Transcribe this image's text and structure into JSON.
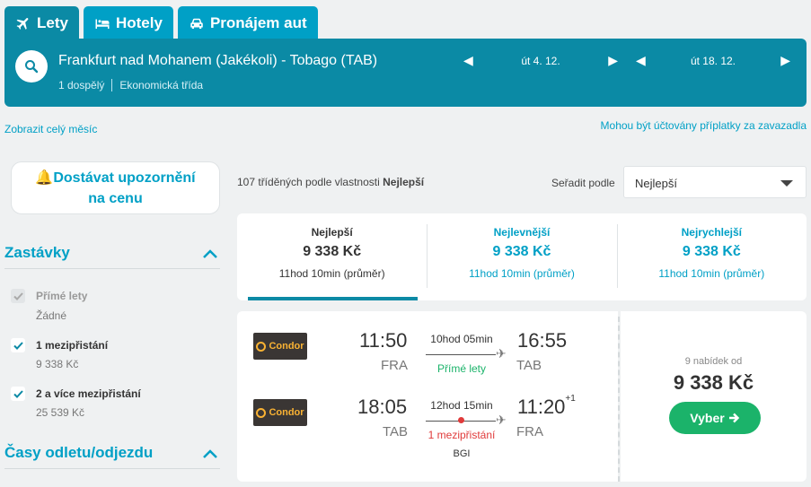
{
  "tabs": [
    {
      "label": "Lety",
      "icon": "plane-icon"
    },
    {
      "label": "Hotely",
      "icon": "bed-icon"
    },
    {
      "label": "Pronájem aut",
      "icon": "car-icon"
    }
  ],
  "search": {
    "route": "Frankfurt nad Mohanem (Jakékoli) - Tobago (TAB)",
    "passengers": "1 dospělý",
    "cabin": "Ekonomická třída",
    "depart_date": "út 4. 12.",
    "return_date": "út 18. 12."
  },
  "links": {
    "whole_month": "Zobrazit celý měsíc",
    "baggage_fees": "Mohou být účtovány příplatky za zavazadla"
  },
  "sidebar": {
    "alert_line1": "Dostávat upozornění",
    "alert_line2": "na cenu",
    "stops_title": "Zastávky",
    "stops": [
      {
        "label": "Přímé lety",
        "sub": "Žádné",
        "checked": true,
        "disabled": true
      },
      {
        "label": "1 mezipřistání",
        "sub": "9 338 Kč",
        "checked": true,
        "disabled": false
      },
      {
        "label": "2 a více mezipřistání",
        "sub": "25 539 Kč",
        "checked": true,
        "disabled": false
      }
    ],
    "times_title": "Časy odletu/odjezdu"
  },
  "results": {
    "count_prefix": "107 tříděných podle vlastnosti",
    "count_sort": "Nejlepší",
    "sort_label": "Seřadit podle",
    "sort_value": "Nejlepší"
  },
  "categories": [
    {
      "name": "Nejlepší",
      "price": "9 338 Kč",
      "time": "11hod 10min (průměr)"
    },
    {
      "name": "Nejlevnější",
      "price": "9 338 Kč",
      "time": "11hod 10min (průměr)"
    },
    {
      "name": "Nejrychlejší",
      "price": "9 338 Kč",
      "time": "11hod 10min (průměr)"
    }
  ],
  "itinerary": {
    "outbound": {
      "airline": "Condor",
      "dep_time": "11:50",
      "dep_airport": "FRA",
      "duration": "10hod 05min",
      "stops": "Přímé lety",
      "arr_time": "16:55",
      "arr_airport": "TAB",
      "plus_days": ""
    },
    "inbound": {
      "airline": "Condor",
      "dep_time": "18:05",
      "dep_airport": "TAB",
      "duration": "12hod 15min",
      "stops": "1 mezipřistání",
      "stop_code": "BGI",
      "arr_time": "11:20",
      "arr_airport": "FRA",
      "plus_days": "+1"
    },
    "offers_text": "9 nabídek od",
    "price": "9 338 Kč",
    "select_label": "Vyber"
  },
  "colors": {
    "brand_dark": "#0b8aa5",
    "brand": "#00a0c6",
    "green": "#1bb36a",
    "red": "#e03a3a"
  }
}
